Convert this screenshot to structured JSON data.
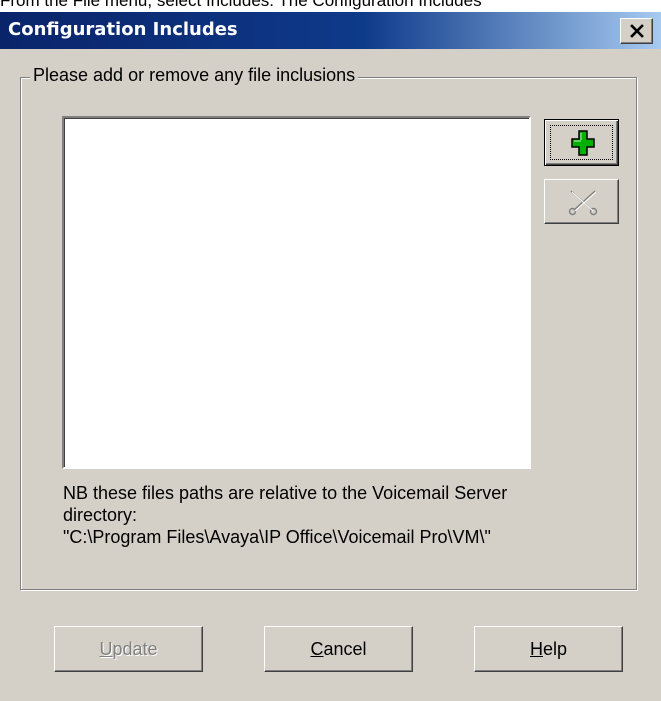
{
  "background_doc": {
    "text": "From the File menu, select Includes. The Configuration Includes"
  },
  "dialog": {
    "title": "Configuration Includes",
    "close_glyph": "✕",
    "group_label": "Please add or remove any file inclusions",
    "file_list": [],
    "note_lines": [
      "NB these files paths are relative to the Voicemail Server",
      "directory:",
      "\"C:\\Program Files\\Avaya\\IP Office\\Voicemail Pro\\VM\\\""
    ],
    "buttons": {
      "add": {
        "icon": "add-plus-icon",
        "enabled": true,
        "focused": true
      },
      "remove": {
        "icon": "remove-scissors-icon",
        "enabled": false
      },
      "update": {
        "mnemonic": "U",
        "rest": "pdate",
        "enabled": false
      },
      "cancel": {
        "mnemonic": "C",
        "rest": "ancel",
        "enabled": true
      },
      "help": {
        "mnemonic": "H",
        "rest": "elp",
        "enabled": true
      }
    },
    "colors": {
      "title_gradient_start": "#0a246a",
      "title_gradient_end": "#a6caf0",
      "face": "#d4d0c8",
      "plus_icon": "#00b000"
    }
  }
}
